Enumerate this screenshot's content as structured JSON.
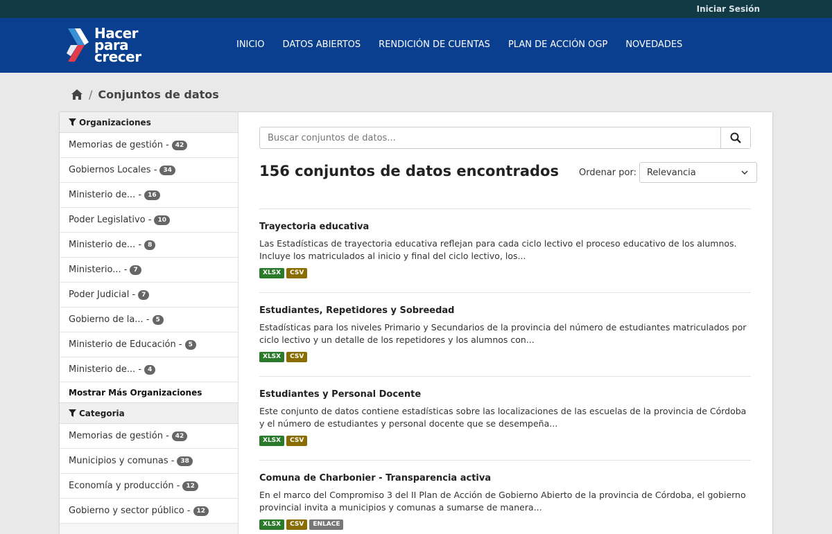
{
  "topbar": {
    "login": "Iniciar Sesión"
  },
  "logo": {
    "line1": "Hacer",
    "line2": "para",
    "line3": "crecer"
  },
  "nav": [
    "INICIO",
    "DATOS ABIERTOS",
    "RENDICIÓN DE CUENTAS",
    "PLAN DE ACCIÓN OGP",
    "NOVEDADES"
  ],
  "breadcrumb": {
    "current": "Conjuntos de datos"
  },
  "sidebar": {
    "organizations_title": "Organizaciones",
    "organizations": [
      {
        "label": "Memorias de gestión -",
        "count": "42"
      },
      {
        "label": "Gobiernos Locales -",
        "count": "34"
      },
      {
        "label": "Ministerio de... -",
        "count": "16"
      },
      {
        "label": "Poder Legislativo -",
        "count": "10"
      },
      {
        "label": "Ministerio de... -",
        "count": "8"
      },
      {
        "label": "Ministerio... -",
        "count": "7"
      },
      {
        "label": "Poder Judicial -",
        "count": "7"
      },
      {
        "label": "Gobierno de la... -",
        "count": "5"
      },
      {
        "label": "Ministerio de Educación -",
        "count": "5"
      },
      {
        "label": "Ministerio de... -",
        "count": "4"
      }
    ],
    "show_more": "Mostrar Más Organizaciones",
    "category_title": "Categoria",
    "categories": [
      {
        "label": "Memorias de gestión -",
        "count": "42"
      },
      {
        "label": "Municipios y comunas -",
        "count": "38"
      },
      {
        "label": "Economía y producción -",
        "count": "12"
      },
      {
        "label": "Gobierno y sector público -",
        "count": "12"
      }
    ]
  },
  "search": {
    "placeholder": "Buscar conjuntos de datos..."
  },
  "results": {
    "title": "156 conjuntos de datos encontrados"
  },
  "sort": {
    "label": "Ordenar por:",
    "selected": "Relevancia"
  },
  "datasets": [
    {
      "title": "Trayectoria educativa",
      "description": "Las Estadísticas de trayectoria educativa reflejan para cada ciclo lectivo el proceso educativo de los alumnos. Incluye los matriculados al inicio y final del ciclo lectivo, los...",
      "formats": [
        "XLSX",
        "CSV"
      ]
    },
    {
      "title": "Estudiantes, Repetidores y Sobreedad",
      "description": "Estadísticas para los niveles Primario y Secundarios de la provincia del número de estudiantes matriculados por ciclo lectivo y un detalle de los repetidores y los alumnos con...",
      "formats": [
        "XLSX",
        "CSV"
      ]
    },
    {
      "title": "Estudiantes y Personal Docente",
      "description": "Este conjunto de datos contiene estadísticas sobre las localizaciones de las escuelas de la provincia de Córdoba y el número de estudiantes y personal docente que se desempeña...",
      "formats": [
        "XLSX",
        "CSV"
      ]
    },
    {
      "title": "Comuna de Charbonier - Transparencia activa",
      "description": "En el marco del Compromiso 3 del II Plan de Acción de Gobierno Abierto de la provincia de Córdoba, el gobierno provincial invita a municipios y comunas a sumarse de manera...",
      "formats": [
        "XLSX",
        "CSV",
        "ENLACE"
      ]
    }
  ]
}
